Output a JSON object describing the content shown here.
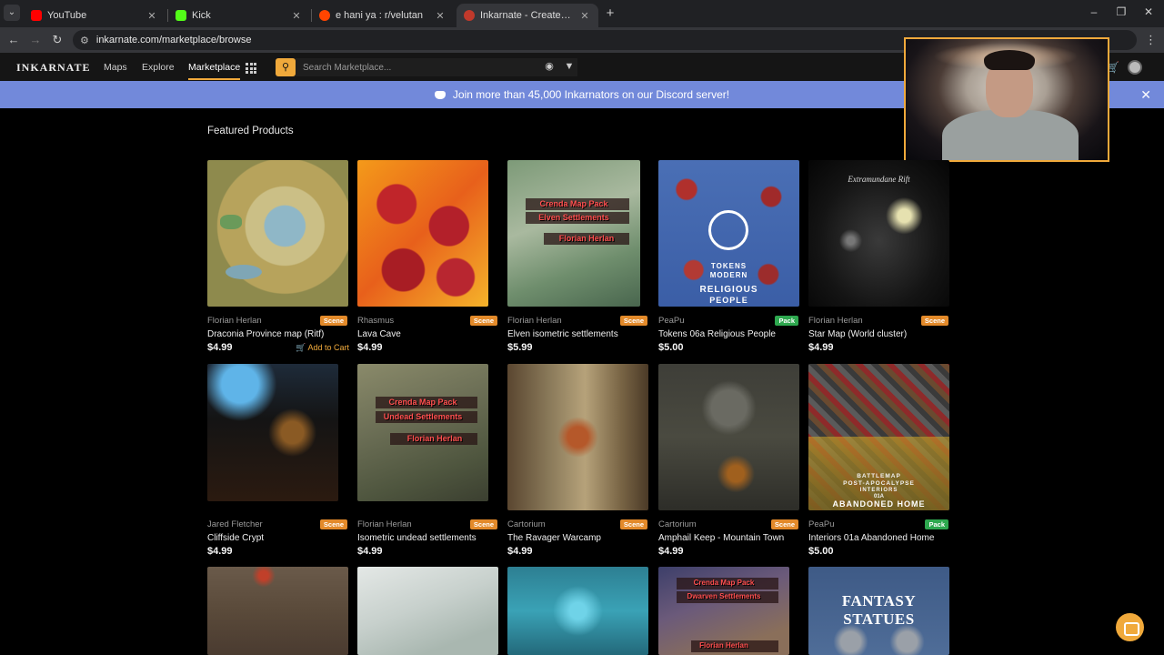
{
  "browser": {
    "tabs": [
      {
        "title": "YouTube",
        "color": "#ff0000"
      },
      {
        "title": "Kick",
        "color": "#53fc18"
      },
      {
        "title": "e hani ya : r/velutan",
        "color": "#ff4500"
      },
      {
        "title": "Inkarnate - Create Fantasy Maps",
        "color": "#c0392b"
      }
    ],
    "url": "inkarnate.com/marketplace/browse"
  },
  "nav": {
    "logo": "INKARNATE",
    "links": [
      "Maps",
      "Explore",
      "Marketplace"
    ],
    "search_placeholder": "Search Marketplace..."
  },
  "banner": {
    "text": "Join more than 45,000 Inkarnators on our Discord server!"
  },
  "section_title": "Featured Products",
  "add_to_cart_label": "Add to Cart",
  "products": [
    {
      "creator": "Florian Herlan",
      "badge": "Scene",
      "name": "Draconia Province map (Ritf)",
      "price": "$4.99"
    },
    {
      "creator": "Rhasmus",
      "badge": "Scene",
      "name": "Lava Cave",
      "price": "$4.99"
    },
    {
      "creator": "Florian Herlan",
      "badge": "Scene",
      "name": "Elven isometric settlements",
      "price": "$5.99",
      "overlay": [
        "Crenda Map Pack",
        "Elven Settlements",
        "Florian Herlan"
      ]
    },
    {
      "creator": "PeaPu",
      "badge": "Pack",
      "name": "Tokens 06a Religious People",
      "price": "$5.00",
      "overlay": [
        "TOKENS",
        "MODERN",
        "RELIGIOUS",
        "PEOPLE"
      ]
    },
    {
      "creator": "Florian Herlan",
      "badge": "Scene",
      "name": "Star Map (World cluster)",
      "price": "$4.99",
      "overlay": [
        "Extramundane Rift"
      ]
    },
    {
      "creator": "Jared Fletcher",
      "badge": "Scene",
      "name": "Cliffside Crypt",
      "price": "$4.99"
    },
    {
      "creator": "Florian Herlan",
      "badge": "Scene",
      "name": "Isometric undead settlements",
      "price": "$4.99",
      "overlay": [
        "Crenda Map Pack",
        "Undead Settlements",
        "Florian Herlan"
      ]
    },
    {
      "creator": "Cartorium",
      "badge": "Scene",
      "name": "The Ravager Warcamp",
      "price": "$4.99"
    },
    {
      "creator": "Cartorium",
      "badge": "Scene",
      "name": "Amphail Keep - Mountain Town",
      "price": "$4.99"
    },
    {
      "creator": "PeaPu",
      "badge": "Pack",
      "name": "Interiors 01a Abandoned Home",
      "price": "$5.00",
      "overlay": [
        "BATTLEMAP",
        "POST-APOCALYPSE",
        "INTERIORS",
        "01A",
        "ABANDONED HOME"
      ]
    },
    {
      "overlay": []
    },
    {
      "overlay": []
    },
    {
      "overlay": []
    },
    {
      "overlay": [
        "Crenda Map Pack",
        "Dwarven Settlements",
        "Florian Herlan"
      ]
    },
    {
      "overlay": [
        "FANTASY STATUES"
      ]
    }
  ],
  "colors": {
    "accent": "#f0a93b",
    "discord": "#7289da",
    "scene_badge": "#e38a2a",
    "pack_badge": "#2ea84f"
  }
}
